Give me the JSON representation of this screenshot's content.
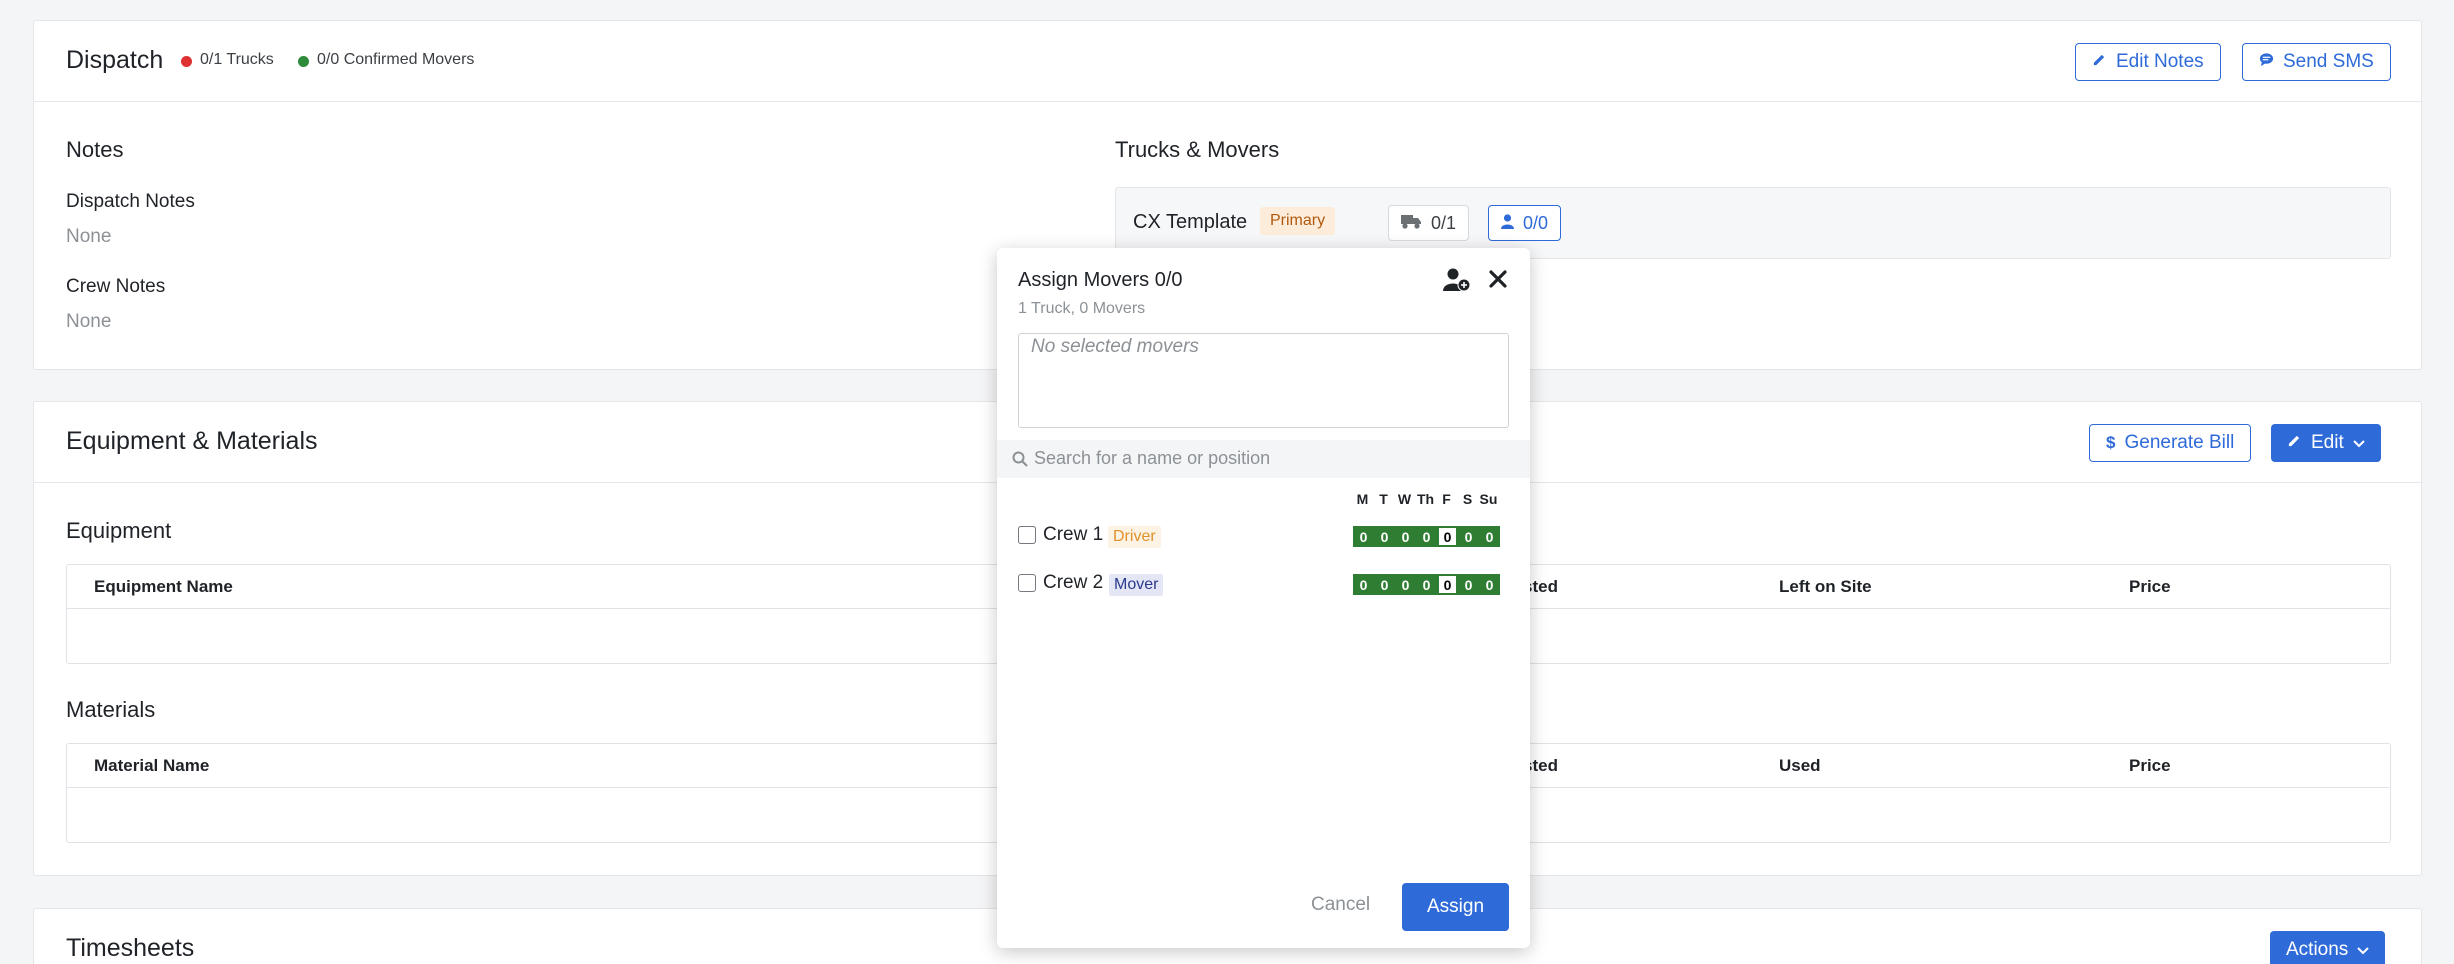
{
  "dispatch": {
    "title": "Dispatch",
    "trucks_status": "0/1 Trucks",
    "movers_status": "0/0 Confirmed Movers",
    "edit_notes": "Edit Notes",
    "send_sms": "Send SMS",
    "notes_heading": "Notes",
    "dispatch_notes_label": "Dispatch Notes",
    "dispatch_notes_value": "None",
    "crew_notes_label": "Crew Notes",
    "crew_notes_value": "None",
    "trucks_movers_heading": "Trucks & Movers",
    "template_name": "CX Template",
    "primary_badge": "Primary",
    "truck_count": "0/1",
    "mover_count": "0/0"
  },
  "equipment": {
    "title": "Equipment & Materials",
    "generate_bill": "Generate Bill",
    "edit": "Edit",
    "equipment_heading": "Equipment",
    "equipment_cols": [
      "Equipment Name",
      "sted",
      "Left on Site",
      "Price"
    ],
    "materials_heading": "Materials",
    "materials_cols": [
      "Material Name",
      "sted",
      "Used",
      "Price"
    ]
  },
  "timesheets": {
    "title": "Timesheets",
    "actions": "Actions"
  },
  "modal": {
    "title": "Assign Movers 0/0",
    "subtitle": "1 Truck, 0 Movers",
    "selected_placeholder": "No selected movers",
    "search_placeholder": "Search for a name or position",
    "days": [
      "M",
      "T",
      "W",
      "Th",
      "F",
      "S",
      "Su"
    ],
    "crew": [
      {
        "name": "Crew 1",
        "role": "Driver",
        "schedule": [
          "0",
          "0",
          "0",
          "0",
          "0",
          "0",
          "0"
        ]
      },
      {
        "name": "Crew 2",
        "role": "Mover",
        "schedule": [
          "0",
          "0",
          "0",
          "0",
          "0",
          "0",
          "0"
        ]
      }
    ],
    "cancel": "Cancel",
    "assign": "Assign"
  },
  "colors": {
    "accent": "#2f6bd8",
    "status_red": "#e03131",
    "status_green": "#2e8b3a",
    "schedule_green": "#2e7d32",
    "driver_badge_text": "#e0912a",
    "mover_badge_bg": "#e4e6f5"
  },
  "icons": [
    "pencil-icon",
    "chat-icon",
    "dollar-icon",
    "chevron-down-icon",
    "truck-icon",
    "person-icon",
    "add-person-icon",
    "close-icon",
    "search-icon"
  ]
}
